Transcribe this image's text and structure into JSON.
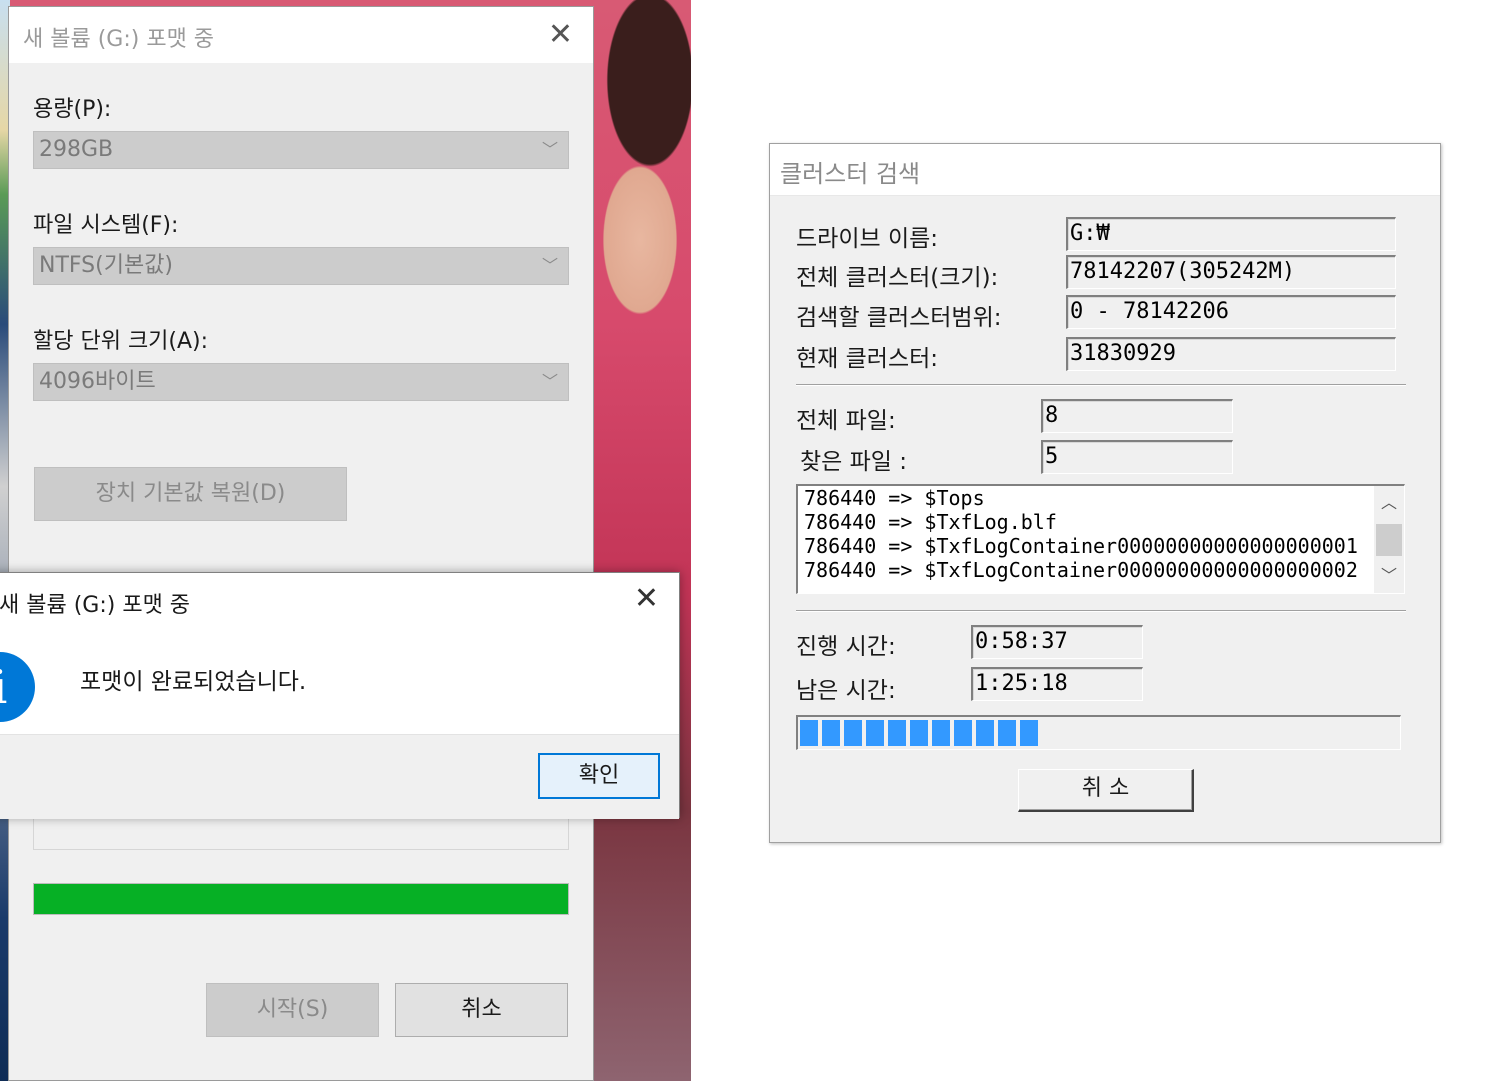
{
  "format_window": {
    "title": "새 볼륨 (G:) 포맷 중",
    "capacity_label": "용량(P):",
    "capacity_value": "298GB",
    "filesystem_label": "파일 시스템(F):",
    "filesystem_value": "NTFS(기본값)",
    "allocation_label": "할당 단위 크기(A):",
    "allocation_value": "4096바이트",
    "restore_defaults_label": "장치 기본값 복원(D)",
    "progress": 1.0,
    "progress_color": "#06b025",
    "start_label": "시작(S)",
    "cancel_label": "취소"
  },
  "message_box": {
    "title": "새 볼륨 (G:) 포맷 중",
    "icon": "info-icon",
    "message": "포맷이 완료되었습니다.",
    "ok_label": "확인"
  },
  "cluster_search": {
    "title": "클러스터 검색",
    "drive_name_label": "드라이브 이름:",
    "drive_name_value": "G:₩",
    "total_clusters_label": "전체 클러스터(크기):",
    "total_clusters_value": "78142207(305242M)",
    "search_range_label": "검색할 클러스터범위:",
    "search_range_value": "0 - 78142206",
    "current_cluster_label": "현재 클러스터:",
    "current_cluster_value": "31830929",
    "total_files_label": "전체 파일:",
    "total_files_value": "8",
    "found_files_label": "찾은 파일 :",
    "found_files_value": "5",
    "file_list": [
      "786440 => $Tops",
      "786440 => $TxfLog.blf",
      "786440 => $TxfLogContainer00000000000000000001",
      "786440 => $TxfLogContainer00000000000000000002"
    ],
    "elapsed_label": "진행 시간:",
    "elapsed_value": "0:58:37",
    "remaining_label": "남은 시간:",
    "remaining_value": "1:25:18",
    "progress_blocks": 11,
    "progress_color": "#3399ff",
    "cancel_label": "취 소"
  }
}
